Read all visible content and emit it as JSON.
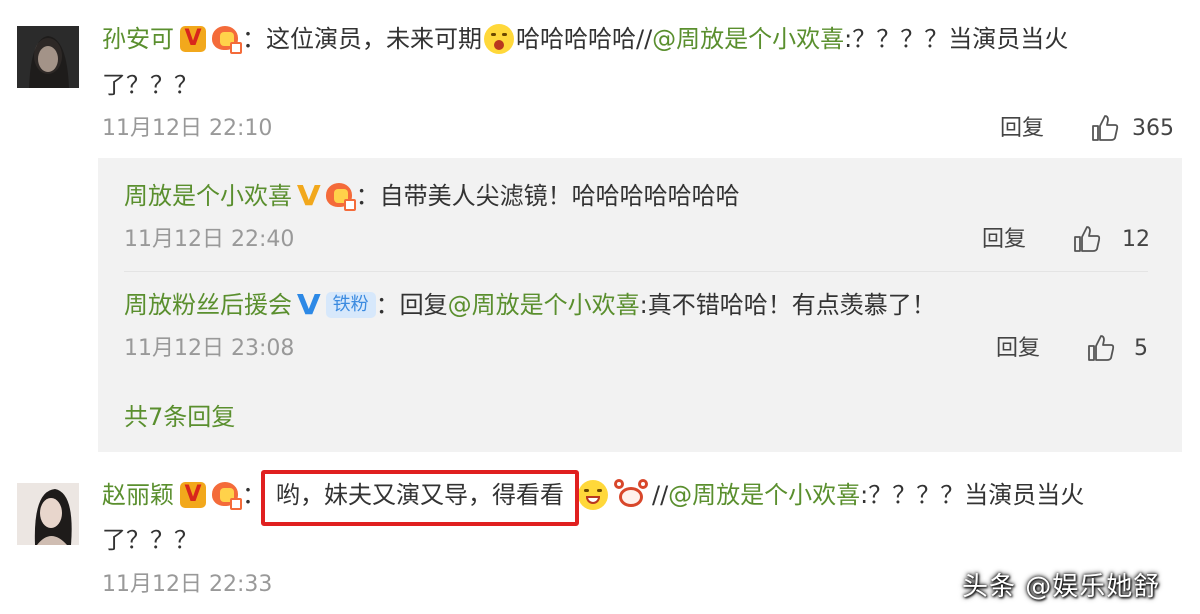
{
  "comments": [
    {
      "user": "孙安可",
      "colon": "：",
      "text1": "这位演员，未来可期",
      "text2": "哈哈哈哈哈//",
      "mention": "@周放是个小欢喜",
      "text3": ":？？？？当演员当火",
      "text4": "了？？？",
      "date": "11月12日 22:10",
      "reply_label": "回复",
      "likes": "365"
    },
    {
      "user": "赵丽颖",
      "colon": "：",
      "text1": "哟，妹夫又演又导，得看看",
      "text2": "//",
      "mention": "@周放是个小欢喜",
      "text3": ":？？？？当演员当火",
      "text4": "了？？？",
      "date": "11月12日 22:33"
    }
  ],
  "replies": [
    {
      "user": "周放是个小欢喜",
      "colon": "：",
      "text": "自带美人尖滤镜！哈哈哈哈哈哈哈",
      "date": "11月12日 22:40",
      "reply_label": "回复",
      "likes": "12"
    },
    {
      "user": "周放粉丝后援会",
      "badge": "铁粉",
      "colon": "：",
      "prefix": "回复",
      "mention": "@周放是个小欢喜",
      "text": ":真不错哈哈！有点羡慕了！",
      "date": "11月12日 23:08",
      "reply_label": "回复",
      "likes": "5"
    }
  ],
  "more_replies": "共7条回复",
  "watermark": "头条 @娱乐她舒",
  "icons": {
    "verified": "verified-v-icon",
    "fan_badge": "fan-badge-icon",
    "like": "thumbs-up-icon",
    "emoji_scream": "scream-emoji-icon",
    "emoji_grin": "grin-emoji-icon",
    "emoji_crab": "crab-emoji-icon"
  },
  "colors": {
    "username": "#5a8f2e",
    "highlight_box": "#e02020",
    "reply_bg": "#f2f2f2",
    "verified_gold": "#f2a81c",
    "verified_blue": "#2d89e6"
  }
}
